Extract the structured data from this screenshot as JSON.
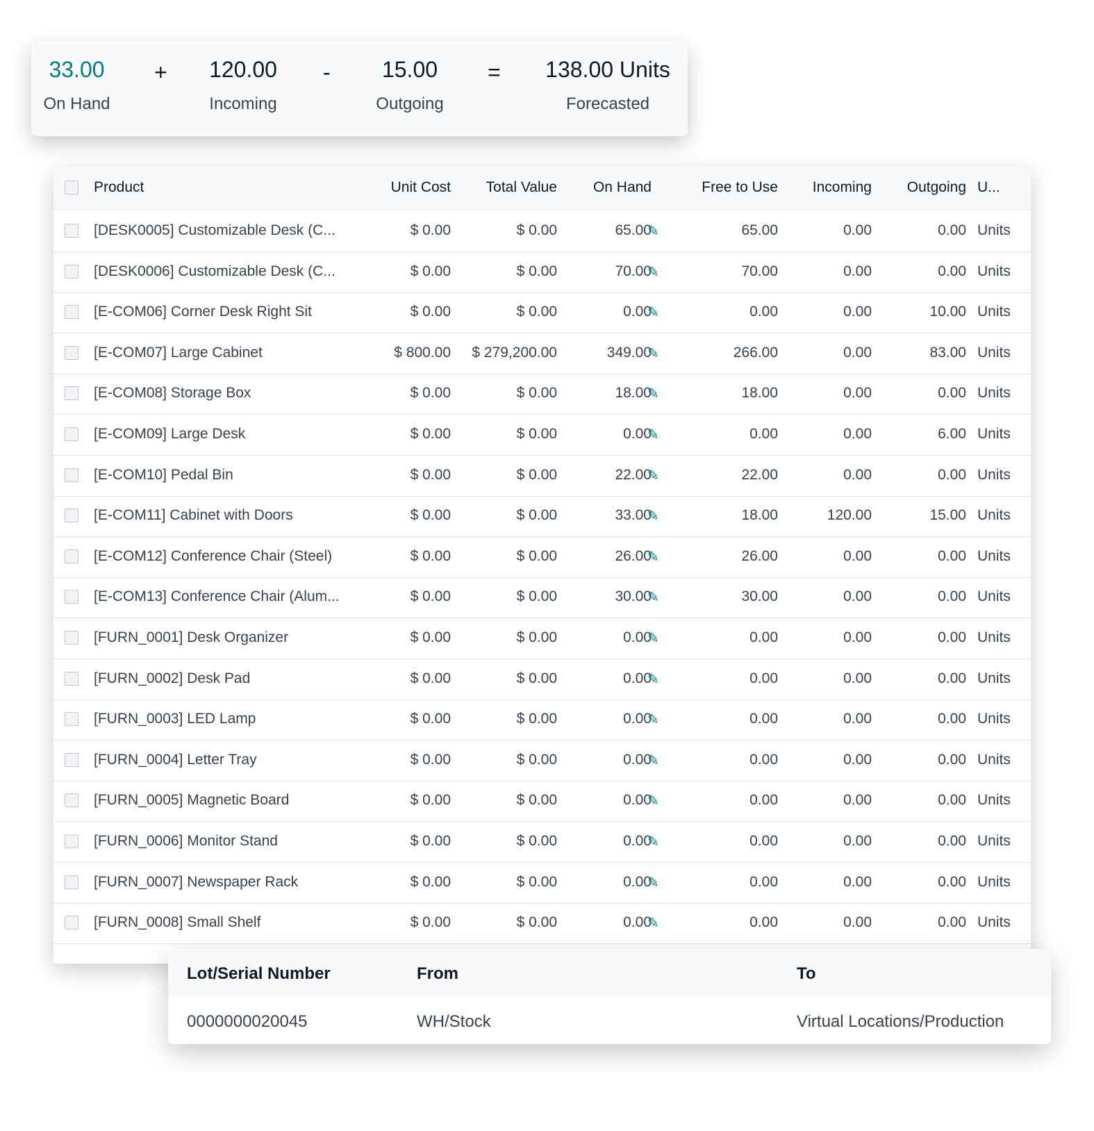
{
  "forecast": {
    "on_hand": "33.00",
    "on_hand_label": "On Hand",
    "plus": "+",
    "incoming": "120.00",
    "incoming_label": "Incoming",
    "minus": "-",
    "outgoing": "15.00",
    "outgoing_label": "Outgoing",
    "equals": "=",
    "forecasted": "138.00 Units",
    "forecasted_label": "Forecasted",
    "accent": "#017e84"
  },
  "table": {
    "headers": [
      "Product",
      "Unit Cost",
      "Total Value",
      "On Hand",
      "Free to Use",
      "Incoming",
      "Outgoing",
      "U..."
    ],
    "rows": [
      [
        "[DESK0005] Customizable Desk (C...",
        "$ 0.00",
        "$ 0.00",
        "65.00",
        "65.00",
        "0.00",
        "0.00",
        "Units"
      ],
      [
        "[DESK0006] Customizable Desk (C...",
        "$ 0.00",
        "$ 0.00",
        "70.00",
        "70.00",
        "0.00",
        "0.00",
        "Units"
      ],
      [
        "[E-COM06] Corner Desk Right Sit",
        "$ 0.00",
        "$ 0.00",
        "0.00",
        "0.00",
        "0.00",
        "10.00",
        "Units"
      ],
      [
        "[E-COM07] Large Cabinet",
        "$ 800.00",
        "$ 279,200.00",
        "349.00",
        "266.00",
        "0.00",
        "83.00",
        "Units"
      ],
      [
        "[E-COM08] Storage Box",
        "$ 0.00",
        "$ 0.00",
        "18.00",
        "18.00",
        "0.00",
        "0.00",
        "Units"
      ],
      [
        "[E-COM09] Large Desk",
        "$ 0.00",
        "$ 0.00",
        "0.00",
        "0.00",
        "0.00",
        "6.00",
        "Units"
      ],
      [
        "[E-COM10] Pedal Bin",
        "$ 0.00",
        "$ 0.00",
        "22.00",
        "22.00",
        "0.00",
        "0.00",
        "Units"
      ],
      [
        "[E-COM11] Cabinet with Doors",
        "$ 0.00",
        "$ 0.00",
        "33.00",
        "18.00",
        "120.00",
        "15.00",
        "Units"
      ],
      [
        "[E-COM12] Conference Chair (Steel)",
        "$ 0.00",
        "$ 0.00",
        "26.00",
        "26.00",
        "0.00",
        "0.00",
        "Units"
      ],
      [
        "[E-COM13] Conference Chair (Alum...",
        "$ 0.00",
        "$ 0.00",
        "30.00",
        "30.00",
        "0.00",
        "0.00",
        "Units"
      ],
      [
        "[FURN_0001] Desk Organizer",
        "$ 0.00",
        "$ 0.00",
        "0.00",
        "0.00",
        "0.00",
        "0.00",
        "Units"
      ],
      [
        "[FURN_0002] Desk Pad",
        "$ 0.00",
        "$ 0.00",
        "0.00",
        "0.00",
        "0.00",
        "0.00",
        "Units"
      ],
      [
        "[FURN_0003] LED Lamp",
        "$ 0.00",
        "$ 0.00",
        "0.00",
        "0.00",
        "0.00",
        "0.00",
        "Units"
      ],
      [
        "[FURN_0004] Letter Tray",
        "$ 0.00",
        "$ 0.00",
        "0.00",
        "0.00",
        "0.00",
        "0.00",
        "Units"
      ],
      [
        "[FURN_0005] Magnetic Board",
        "$ 0.00",
        "$ 0.00",
        "0.00",
        "0.00",
        "0.00",
        "0.00",
        "Units"
      ],
      [
        "[FURN_0006] Monitor Stand",
        "$ 0.00",
        "$ 0.00",
        "0.00",
        "0.00",
        "0.00",
        "0.00",
        "Units"
      ],
      [
        "[FURN_0007] Newspaper Rack",
        "$ 0.00",
        "$ 0.00",
        "0.00",
        "0.00",
        "0.00",
        "0.00",
        "Units"
      ],
      [
        "[FURN_0008] Small Shelf",
        "$ 0.00",
        "$ 0.00",
        "0.00",
        "0.00",
        "0.00",
        "0.00",
        "Units"
      ]
    ]
  },
  "lot": {
    "headers": [
      "Lot/Serial Number",
      "From",
      "To"
    ],
    "row": [
      "0000000020045",
      "WH/Stock",
      "Virtual Locations/Production"
    ]
  }
}
